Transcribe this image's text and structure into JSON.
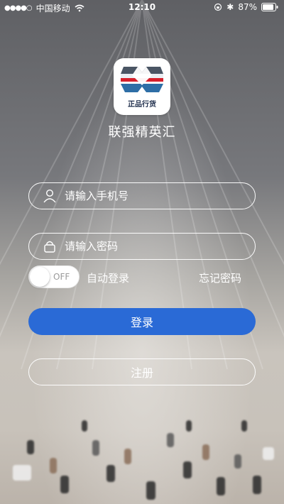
{
  "status_bar": {
    "carrier": "中国移动",
    "time": "12:10",
    "battery": "87%"
  },
  "logo": {
    "tagline": "正品行货"
  },
  "app": {
    "name": "联强精英汇"
  },
  "form": {
    "phone_placeholder": "请输入手机号",
    "password_placeholder": "请输入密码",
    "toggle_state": "OFF",
    "auto_login_label": "自动登录",
    "forgot_password_label": "忘记密码",
    "login_label": "登录",
    "register_label": "注册"
  },
  "colors": {
    "primary_button": "#2a6ad6"
  }
}
